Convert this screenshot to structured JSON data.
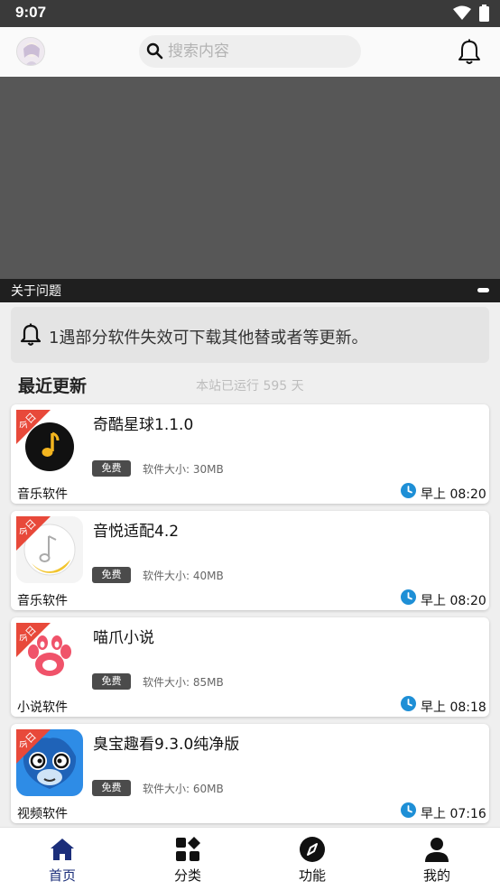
{
  "status_bar": {
    "time": "9:07"
  },
  "header": {
    "search_placeholder": "搜索内容"
  },
  "banner": {
    "caption": "关于问题"
  },
  "notice": {
    "text": "1遇部分软件失效可下载其他替或者等更新。"
  },
  "section": {
    "title": "最近更新",
    "runtime": "本站已运行 595 天"
  },
  "apps": [
    {
      "ribbon": "今日",
      "name": "奇酷星球1.1.0",
      "badge": "免费",
      "size": "软件大小: 30MB",
      "category": "音乐软件",
      "time": "早上 08:20",
      "icon": "music-note-icon"
    },
    {
      "ribbon": "今日",
      "name": "音悦适配4.2",
      "badge": "免费",
      "size": "软件大小: 40MB",
      "category": "音乐软件",
      "time": "早上 08:20",
      "icon": "music-disc-icon"
    },
    {
      "ribbon": "今日",
      "name": "喵爪小说",
      "badge": "免费",
      "size": "软件大小: 85MB",
      "category": "小说软件",
      "time": "早上 08:18",
      "icon": "cat-paw-icon"
    },
    {
      "ribbon": "今日",
      "name": "臭宝趣看9.3.0纯净版",
      "badge": "免费",
      "size": "软件大小: 60MB",
      "category": "视频软件",
      "time": "早上 07:16",
      "icon": "monkey-icon"
    }
  ],
  "nav": [
    {
      "label": "首页",
      "icon": "home-icon",
      "active": true
    },
    {
      "label": "分类",
      "icon": "category-grid-icon",
      "active": false
    },
    {
      "label": "功能",
      "icon": "compass-icon",
      "active": false
    },
    {
      "label": "我的",
      "icon": "person-icon",
      "active": false
    }
  ],
  "colors": {
    "accent": "#1b2e7a",
    "ribbon": "#e8493a",
    "clock": "#1e8fd6",
    "status_bar": "#3a3a3a"
  }
}
